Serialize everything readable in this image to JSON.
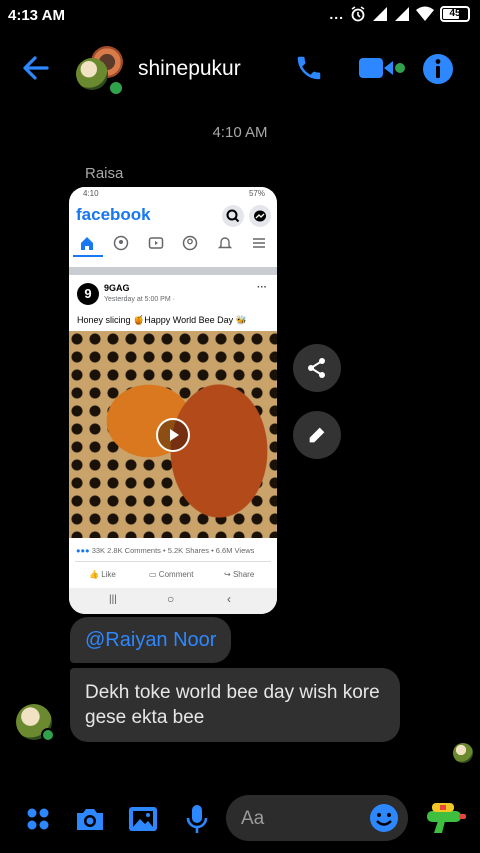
{
  "status": {
    "time": "4:13 AM",
    "dots": "...",
    "battery": "45"
  },
  "header": {
    "contact_name": "shinepukur"
  },
  "chat": {
    "timestamp": "4:10 AM",
    "sender_name": "Raisa",
    "mention": "@Raiyan Noor",
    "message": "Dekh toke world bee day wish kore gese ekta bee"
  },
  "screenshot": {
    "status_time": "4:10",
    "status_battery": "57%",
    "app_name": "facebook",
    "post_author": "9GAG",
    "post_meta": "Yesterday at 5:00 PM · ",
    "post_text": "Honey slicing 🍯Happy World Bee Day 🐝",
    "reactions_count": "33K",
    "comments_count": "2.8K Comments",
    "shares_count": "5.2K Shares",
    "views_count": "6.6M Views",
    "like_label": "Like",
    "comment_label": "Comment",
    "share_label": "Share"
  },
  "composer": {
    "placeholder": "Aa"
  },
  "colors": {
    "accent": "#1877f2",
    "online": "#31a24c",
    "bubble": "#303030"
  }
}
